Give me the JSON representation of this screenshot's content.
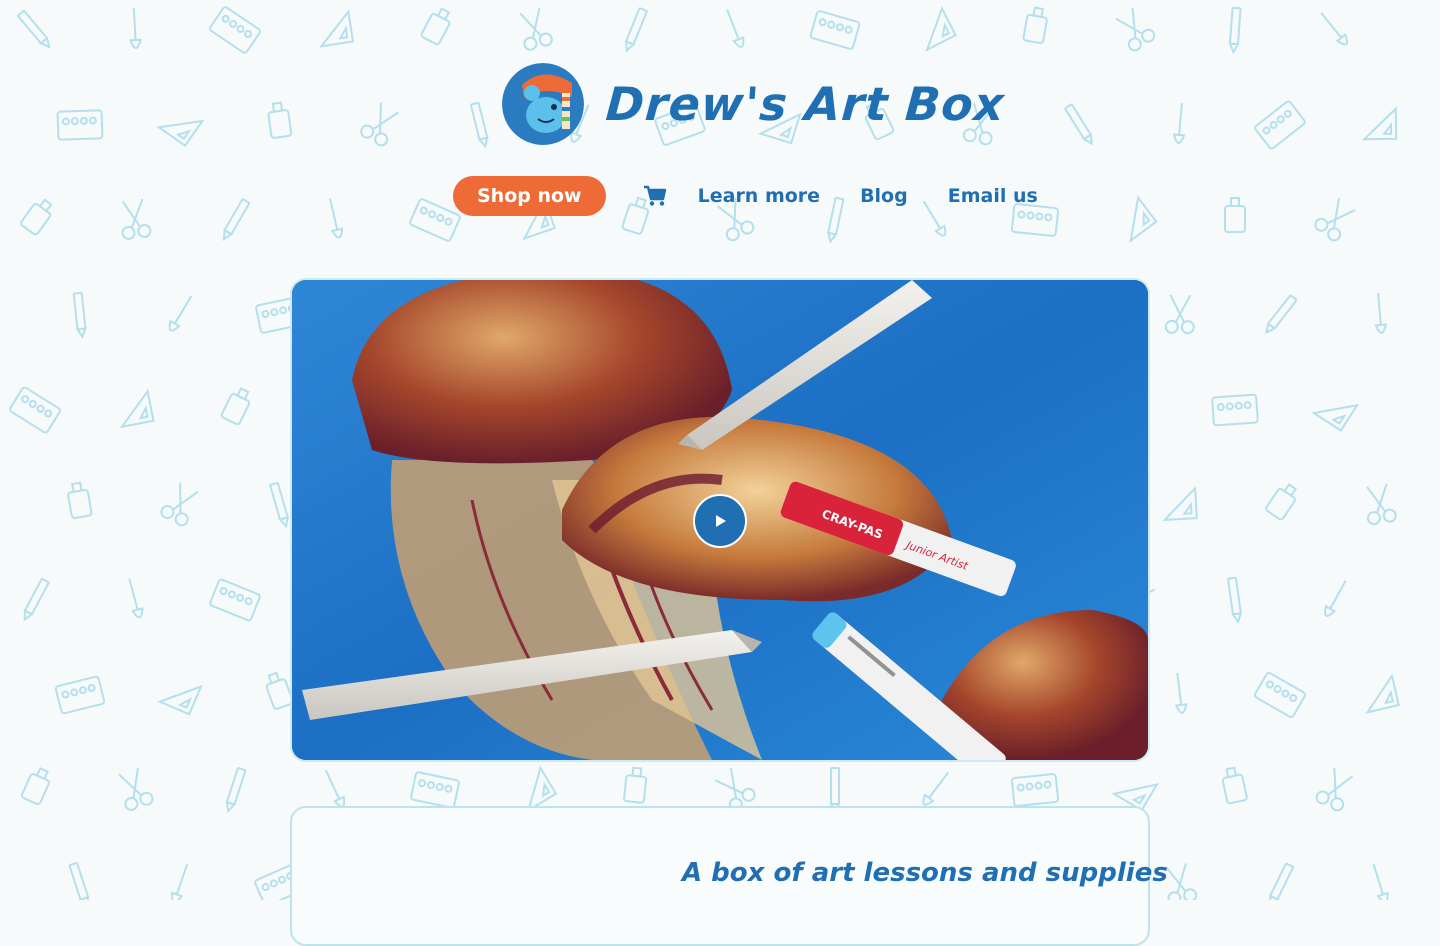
{
  "brand": {
    "name": "Drew's Art Box",
    "logo_icon": "mascot-logo-icon"
  },
  "nav": {
    "shop_label": "Shop now",
    "cart_icon": "cart-icon",
    "links": [
      "Learn more",
      "Blog",
      "Email us"
    ]
  },
  "hero": {
    "video_icon": "play-icon",
    "pastel_label_1": "CRAY-PAS",
    "pastel_label_2": "Junior Artist"
  },
  "intro": {
    "tagline": "A box of art lessons and supplies"
  },
  "colors": {
    "accent_orange": "#ee6a36",
    "brand_blue": "#1f6fb2",
    "pattern_blue": "#9fd6e8",
    "background": "#f6fafb"
  }
}
